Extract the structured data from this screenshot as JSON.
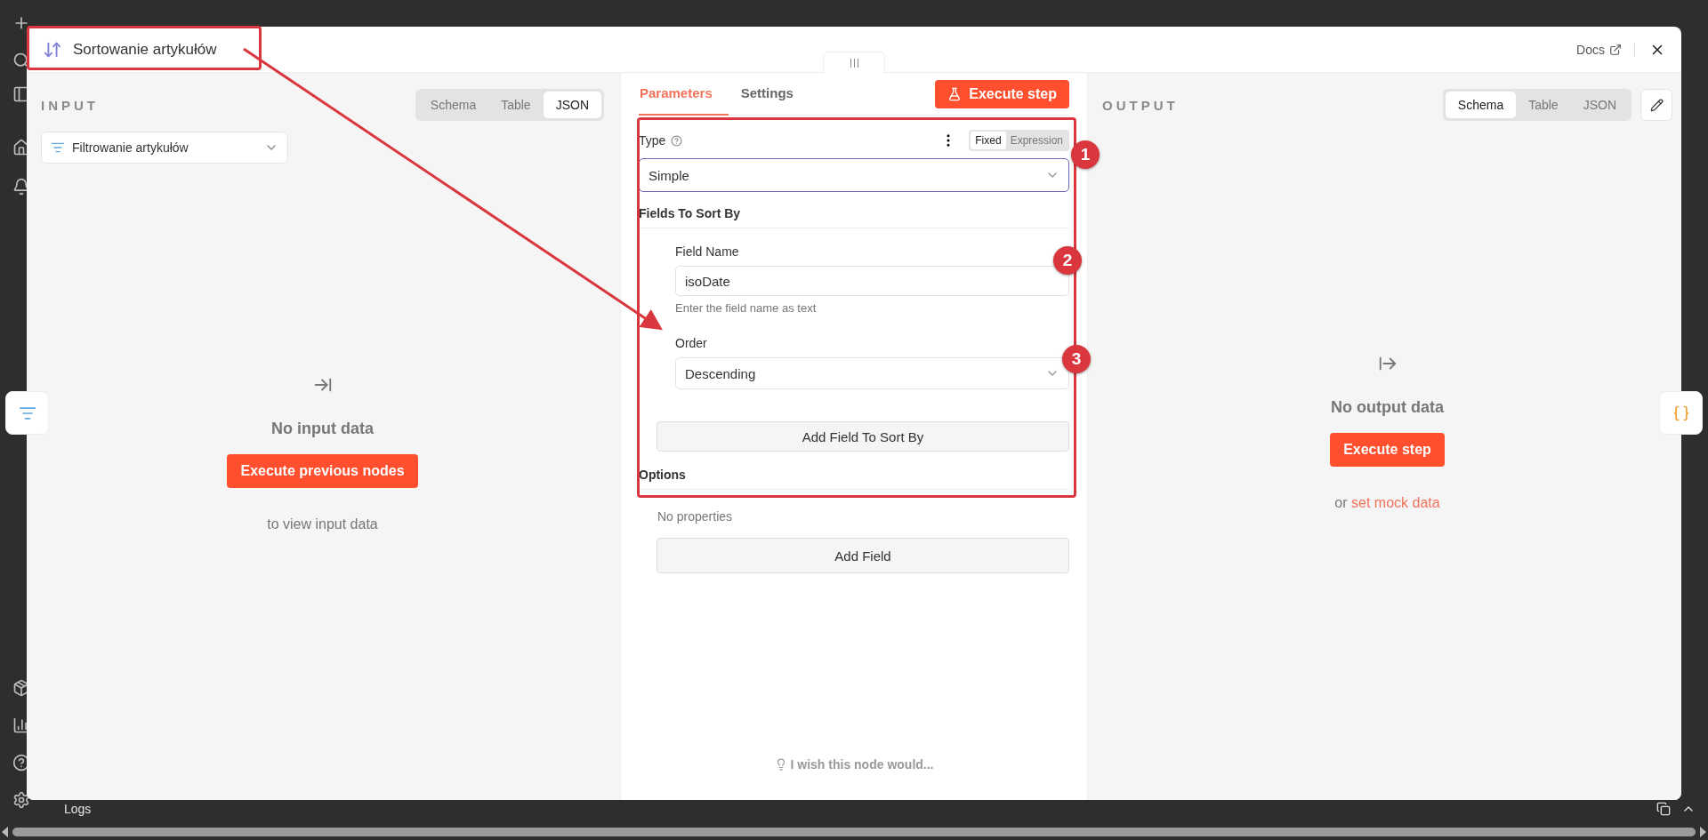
{
  "app": {
    "logs_label": "Logs"
  },
  "modal": {
    "title": "Sortowanie artykułów",
    "docs_link": "Docs"
  },
  "input_panel": {
    "heading": "INPUT",
    "view_tabs": [
      {
        "label": "Schema",
        "selected": false
      },
      {
        "label": "Table",
        "selected": false
      },
      {
        "label": "JSON",
        "selected": true
      }
    ],
    "source_select": {
      "value": "Filtrowanie artykułów"
    },
    "empty_state": {
      "title": "No input data",
      "button": "Execute previous nodes",
      "hint": "to view input data"
    }
  },
  "parameters_panel": {
    "tabs": [
      {
        "label": "Parameters",
        "selected": true
      },
      {
        "label": "Settings",
        "selected": false
      }
    ],
    "execute_button": "Execute step",
    "type_field": {
      "label": "Type",
      "mode_toggle": [
        {
          "label": "Fixed",
          "selected": true
        },
        {
          "label": "Expression",
          "selected": false
        }
      ],
      "value": "Simple"
    },
    "section_title": "Fields To Sort By",
    "field_name": {
      "label": "Field Name",
      "value": "isoDate",
      "hint": "Enter the field name as text"
    },
    "order": {
      "label": "Order",
      "value": "Descending"
    },
    "add_sort_button": "Add Field To Sort By",
    "options_title": "Options",
    "options_empty": "No properties",
    "add_field_button": "Add Field",
    "feedback": "I wish this node would..."
  },
  "output_panel": {
    "heading": "OUTPUT",
    "view_tabs": [
      {
        "label": "Schema",
        "selected": true
      },
      {
        "label": "Table",
        "selected": false
      },
      {
        "label": "JSON",
        "selected": false
      }
    ],
    "empty_state": {
      "title": "No output data",
      "button": "Execute step",
      "hint_prefix": "or",
      "hint_link": "set mock data"
    }
  },
  "annotations": {
    "markers": [
      "1",
      "2",
      "3"
    ]
  }
}
